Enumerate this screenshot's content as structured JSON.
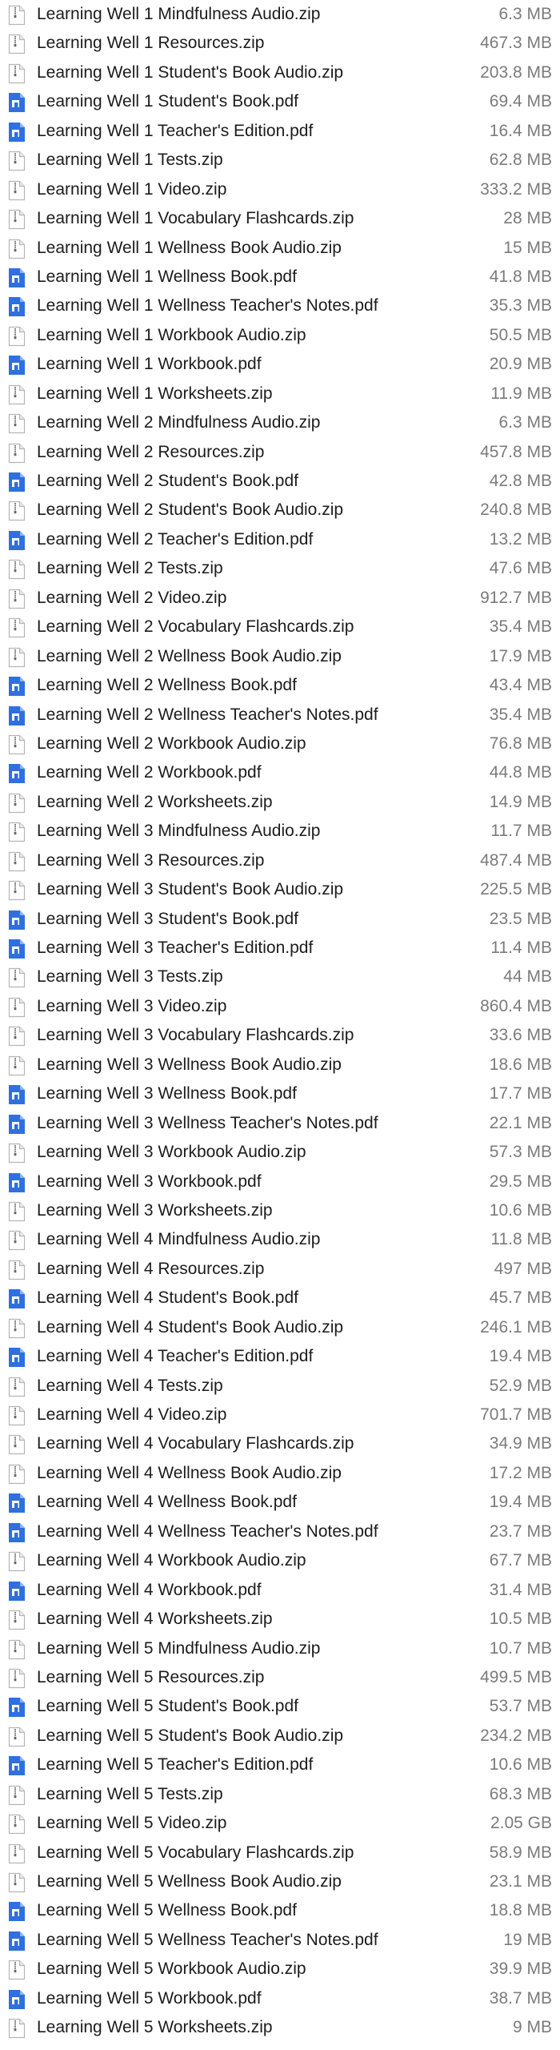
{
  "files": [
    {
      "name": "Learning Well 1 Mindfulness Audio.zip",
      "size": "6.3 MB",
      "icon": "zip-file-icon"
    },
    {
      "name": "Learning Well 1 Resources.zip",
      "size": "467.3 MB",
      "icon": "zip-file-icon"
    },
    {
      "name": "Learning Well 1 Student's Book Audio.zip",
      "size": "203.8 MB",
      "icon": "zip-file-icon"
    },
    {
      "name": "Learning Well 1 Student's Book.pdf",
      "size": "69.4 MB",
      "icon": "pdf-file-icon"
    },
    {
      "name": "Learning Well 1 Teacher's Edition.pdf",
      "size": "16.4 MB",
      "icon": "pdf-file-icon"
    },
    {
      "name": "Learning Well 1 Tests.zip",
      "size": "62.8 MB",
      "icon": "zip-file-icon"
    },
    {
      "name": "Learning Well 1 Video.zip",
      "size": "333.2 MB",
      "icon": "zip-file-icon"
    },
    {
      "name": "Learning Well 1 Vocabulary Flashcards.zip",
      "size": "28 MB",
      "icon": "zip-file-icon"
    },
    {
      "name": "Learning Well 1 Wellness Book Audio.zip",
      "size": "15 MB",
      "icon": "zip-file-icon"
    },
    {
      "name": "Learning Well 1 Wellness Book.pdf",
      "size": "41.8 MB",
      "icon": "pdf-file-icon"
    },
    {
      "name": "Learning Well 1 Wellness Teacher's Notes.pdf",
      "size": "35.3 MB",
      "icon": "pdf-file-icon"
    },
    {
      "name": "Learning Well 1 Workbook Audio.zip",
      "size": "50.5 MB",
      "icon": "zip-file-icon"
    },
    {
      "name": "Learning Well 1 Workbook.pdf",
      "size": "20.9 MB",
      "icon": "pdf-file-icon"
    },
    {
      "name": "Learning Well 1 Worksheets.zip",
      "size": "11.9 MB",
      "icon": "zip-file-icon"
    },
    {
      "name": "Learning Well 2 Mindfulness Audio.zip",
      "size": "6.3 MB",
      "icon": "zip-file-icon"
    },
    {
      "name": "Learning Well 2 Resources.zip",
      "size": "457.8 MB",
      "icon": "zip-file-icon"
    },
    {
      "name": "Learning Well 2 Student's Book.pdf",
      "size": "42.8 MB",
      "icon": "pdf-file-icon"
    },
    {
      "name": "Learning Well 2 Student's Book Audio.zip",
      "size": "240.8 MB",
      "icon": "zip-file-icon"
    },
    {
      "name": "Learning Well 2 Teacher's Edition.pdf",
      "size": "13.2 MB",
      "icon": "pdf-file-icon"
    },
    {
      "name": "Learning Well 2 Tests.zip",
      "size": "47.6 MB",
      "icon": "zip-file-icon"
    },
    {
      "name": "Learning Well 2 Video.zip",
      "size": "912.7 MB",
      "icon": "zip-file-icon"
    },
    {
      "name": "Learning Well 2 Vocabulary Flashcards.zip",
      "size": "35.4 MB",
      "icon": "zip-file-icon"
    },
    {
      "name": "Learning Well 2 Wellness Book Audio.zip",
      "size": "17.9 MB",
      "icon": "zip-file-icon"
    },
    {
      "name": "Learning Well 2 Wellness Book.pdf",
      "size": "43.4 MB",
      "icon": "pdf-file-icon"
    },
    {
      "name": "Learning Well 2 Wellness Teacher's Notes.pdf",
      "size": "35.4 MB",
      "icon": "pdf-file-icon"
    },
    {
      "name": "Learning Well 2 Workbook Audio.zip",
      "size": "76.8 MB",
      "icon": "zip-file-icon"
    },
    {
      "name": "Learning Well 2 Workbook.pdf",
      "size": "44.8 MB",
      "icon": "pdf-file-icon"
    },
    {
      "name": "Learning Well 2 Worksheets.zip",
      "size": "14.9 MB",
      "icon": "zip-file-icon"
    },
    {
      "name": "Learning Well 3 Mindfulness Audio.zip",
      "size": "11.7 MB",
      "icon": "zip-file-icon"
    },
    {
      "name": "Learning Well 3 Resources.zip",
      "size": "487.4 MB",
      "icon": "zip-file-icon"
    },
    {
      "name": "Learning Well 3 Student's Book Audio.zip",
      "size": "225.5 MB",
      "icon": "zip-file-icon"
    },
    {
      "name": "Learning Well 3 Student's Book.pdf",
      "size": "23.5 MB",
      "icon": "pdf-file-icon"
    },
    {
      "name": "Learning Well 3 Teacher's Edition.pdf",
      "size": "11.4 MB",
      "icon": "pdf-file-icon"
    },
    {
      "name": "Learning Well 3 Tests.zip",
      "size": "44 MB",
      "icon": "zip-file-icon"
    },
    {
      "name": "Learning Well 3 Video.zip",
      "size": "860.4 MB",
      "icon": "zip-file-icon"
    },
    {
      "name": "Learning Well 3 Vocabulary Flashcards.zip",
      "size": "33.6 MB",
      "icon": "zip-file-icon"
    },
    {
      "name": "Learning Well 3 Wellness Book Audio.zip",
      "size": "18.6 MB",
      "icon": "zip-file-icon"
    },
    {
      "name": "Learning Well 3 Wellness Book.pdf",
      "size": "17.7 MB",
      "icon": "pdf-file-icon"
    },
    {
      "name": "Learning Well 3 Wellness Teacher's Notes.pdf",
      "size": "22.1 MB",
      "icon": "pdf-file-icon"
    },
    {
      "name": "Learning Well 3 Workbook Audio.zip",
      "size": "57.3 MB",
      "icon": "zip-file-icon"
    },
    {
      "name": "Learning Well 3 Workbook.pdf",
      "size": "29.5 MB",
      "icon": "pdf-file-icon"
    },
    {
      "name": "Learning Well 3 Worksheets.zip",
      "size": "10.6 MB",
      "icon": "zip-file-icon"
    },
    {
      "name": "Learning Well 4 Mindfulness Audio.zip",
      "size": "11.8 MB",
      "icon": "zip-file-icon"
    },
    {
      "name": "Learning Well 4 Resources.zip",
      "size": "497 MB",
      "icon": "zip-file-icon"
    },
    {
      "name": "Learning Well 4 Student's Book.pdf",
      "size": "45.7 MB",
      "icon": "pdf-file-icon"
    },
    {
      "name": "Learning Well 4 Student's Book Audio.zip",
      "size": "246.1 MB",
      "icon": "zip-file-icon"
    },
    {
      "name": "Learning Well 4 Teacher's Edition.pdf",
      "size": "19.4 MB",
      "icon": "pdf-file-icon"
    },
    {
      "name": "Learning Well 4 Tests.zip",
      "size": "52.9 MB",
      "icon": "zip-file-icon"
    },
    {
      "name": "Learning Well 4 Video.zip",
      "size": "701.7 MB",
      "icon": "zip-file-icon"
    },
    {
      "name": "Learning Well 4 Vocabulary Flashcards.zip",
      "size": "34.9 MB",
      "icon": "zip-file-icon"
    },
    {
      "name": "Learning Well 4 Wellness Book Audio.zip",
      "size": "17.2 MB",
      "icon": "zip-file-icon"
    },
    {
      "name": "Learning Well 4 Wellness Book.pdf",
      "size": "19.4 MB",
      "icon": "pdf-file-icon"
    },
    {
      "name": "Learning Well 4 Wellness Teacher's Notes.pdf",
      "size": "23.7 MB",
      "icon": "pdf-file-icon"
    },
    {
      "name": "Learning Well 4 Workbook Audio.zip",
      "size": "67.7 MB",
      "icon": "zip-file-icon"
    },
    {
      "name": "Learning Well 4 Workbook.pdf",
      "size": "31.4 MB",
      "icon": "pdf-file-icon"
    },
    {
      "name": "Learning Well 4 Worksheets.zip",
      "size": "10.5 MB",
      "icon": "zip-file-icon"
    },
    {
      "name": "Learning Well 5 Mindfulness Audio.zip",
      "size": "10.7 MB",
      "icon": "zip-file-icon"
    },
    {
      "name": "Learning Well 5 Resources.zip",
      "size": "499.5 MB",
      "icon": "zip-file-icon"
    },
    {
      "name": "Learning Well 5 Student's Book.pdf",
      "size": "53.7 MB",
      "icon": "pdf-file-icon"
    },
    {
      "name": "Learning Well 5 Student's Book Audio.zip",
      "size": "234.2 MB",
      "icon": "zip-file-icon"
    },
    {
      "name": "Learning Well 5 Teacher's Edition.pdf",
      "size": "10.6 MB",
      "icon": "pdf-file-icon"
    },
    {
      "name": "Learning Well 5 Tests.zip",
      "size": "68.3 MB",
      "icon": "zip-file-icon"
    },
    {
      "name": "Learning Well 5 Video.zip",
      "size": "2.05 GB",
      "icon": "zip-file-icon"
    },
    {
      "name": "Learning Well 5 Vocabulary Flashcards.zip",
      "size": "58.9 MB",
      "icon": "zip-file-icon"
    },
    {
      "name": "Learning Well 5 Wellness Book Audio.zip",
      "size": "23.1 MB",
      "icon": "zip-file-icon"
    },
    {
      "name": "Learning Well 5 Wellness Book.pdf",
      "size": "18.8 MB",
      "icon": "pdf-file-icon"
    },
    {
      "name": "Learning Well 5 Wellness Teacher's Notes.pdf",
      "size": "19 MB",
      "icon": "pdf-file-icon"
    },
    {
      "name": "Learning Well 5 Workbook Audio.zip",
      "size": "39.9 MB",
      "icon": "zip-file-icon"
    },
    {
      "name": "Learning Well 5 Workbook.pdf",
      "size": "38.7 MB",
      "icon": "pdf-file-icon"
    },
    {
      "name": "Learning Well 5 Worksheets.zip",
      "size": "9 MB",
      "icon": "zip-file-icon"
    }
  ],
  "colors": {
    "name_text": "#1c1c1e",
    "size_text": "#7b7b7d",
    "pdf_icon": "#2f6fe0",
    "zip_icon_border": "#b5b5b8"
  }
}
